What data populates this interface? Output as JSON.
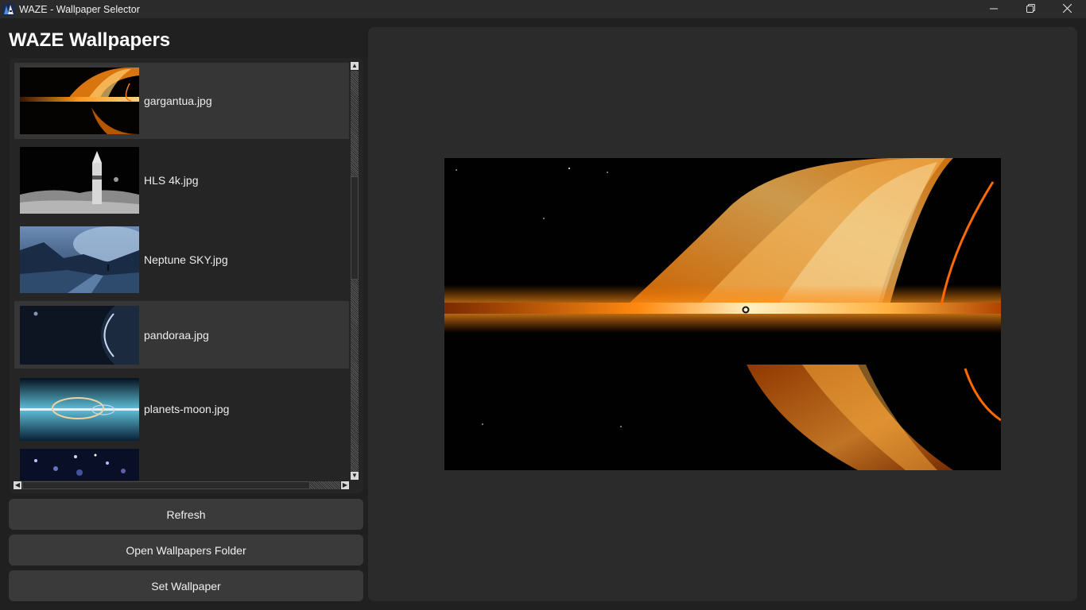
{
  "window": {
    "title": "WAZE - Wallpaper Selector",
    "controls": {
      "minimize_icon": "minimize-icon",
      "maximize_icon": "restore-icon",
      "close_icon": "close-icon"
    }
  },
  "sidebar": {
    "heading": "WAZE Wallpapers",
    "wallpapers": [
      {
        "label": "gargantua.jpg",
        "selected": true,
        "thumb": "black-hole"
      },
      {
        "label": "HLS 4k.jpg",
        "selected": false,
        "thumb": "lunar-rocket"
      },
      {
        "label": "Neptune SKY.jpg",
        "selected": false,
        "thumb": "neptune-sky"
      },
      {
        "label": "pandoraa.jpg",
        "selected": false,
        "hovered": true,
        "thumb": "dark-planet"
      },
      {
        "label": "planets-moon.jpg",
        "selected": false,
        "thumb": "planet-ring"
      },
      {
        "label": "",
        "selected": false,
        "thumb": "galaxy"
      }
    ],
    "buttons": {
      "refresh": "Refresh",
      "open_folder": "Open Wallpapers Folder",
      "set_wallpaper": "Set Wallpaper"
    }
  },
  "preview": {
    "current": "gargantua.jpg",
    "cursor_icon": "busy-cursor-icon"
  },
  "colors": {
    "background": "#202020",
    "panel": "#2b2b2b",
    "button": "#3a3a3a",
    "selected_row": "#363636"
  }
}
